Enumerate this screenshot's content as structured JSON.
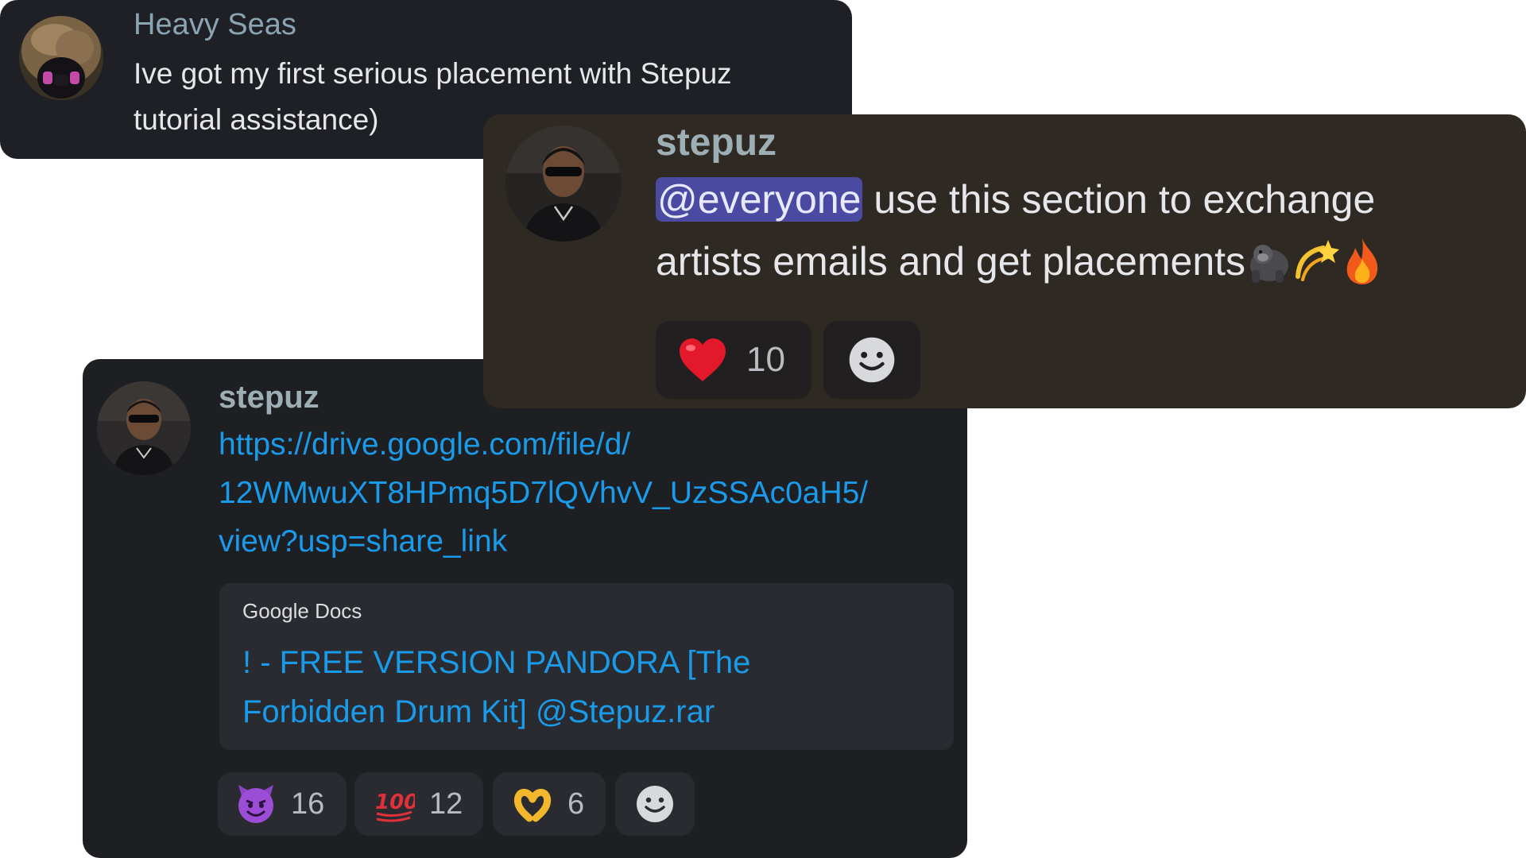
{
  "messages": {
    "heavy_seas": {
      "username": "Heavy Seas",
      "username_color": "#8aa4b3",
      "line1": "Ive got my first serious placement with Stepuz",
      "line2": "tutorial assistance)"
    },
    "announcement": {
      "username": "stepuz",
      "username_color": "#9daeb5",
      "mention": "@everyone",
      "line1_rest": " use this section to exchange",
      "line2": "artists emails and get placements",
      "line2_emojis": [
        "gorilla-emoji",
        "dizzy-emoji",
        "fire-emoji"
      ],
      "reactions": [
        {
          "emoji": "heart-emoji",
          "count": "10"
        }
      ],
      "add_reaction_icon": "add-reaction-icon"
    },
    "drive_link": {
      "username": "stepuz",
      "username_color": "#9daeb5",
      "link_lines": [
        "https://drive.google.com/file/d/",
        "12WMwuXT8HPmq5D7lQVhvV_UzSSAc0aH5/",
        "view?usp=share_link"
      ],
      "embed": {
        "provider": "Google Docs",
        "title_line1": "! - FREE VERSION PANDORA [The",
        "title_line2": "Forbidden Drum Kit] @Stepuz.rar"
      },
      "reactions": [
        {
          "emoji": "smiling-imp-emoji",
          "count": "16"
        },
        {
          "emoji": "hundred-points-emoji",
          "count": "12"
        },
        {
          "emoji": "heart-hands-emoji",
          "count": "6"
        }
      ],
      "add_reaction_icon": "add-reaction-icon"
    }
  },
  "colors": {
    "link": "#1a9bea",
    "mention_bg": "#4b4aa3",
    "reaction_bg_dark": "#2a2b31",
    "reaction_bg_brown": "#211f20"
  }
}
